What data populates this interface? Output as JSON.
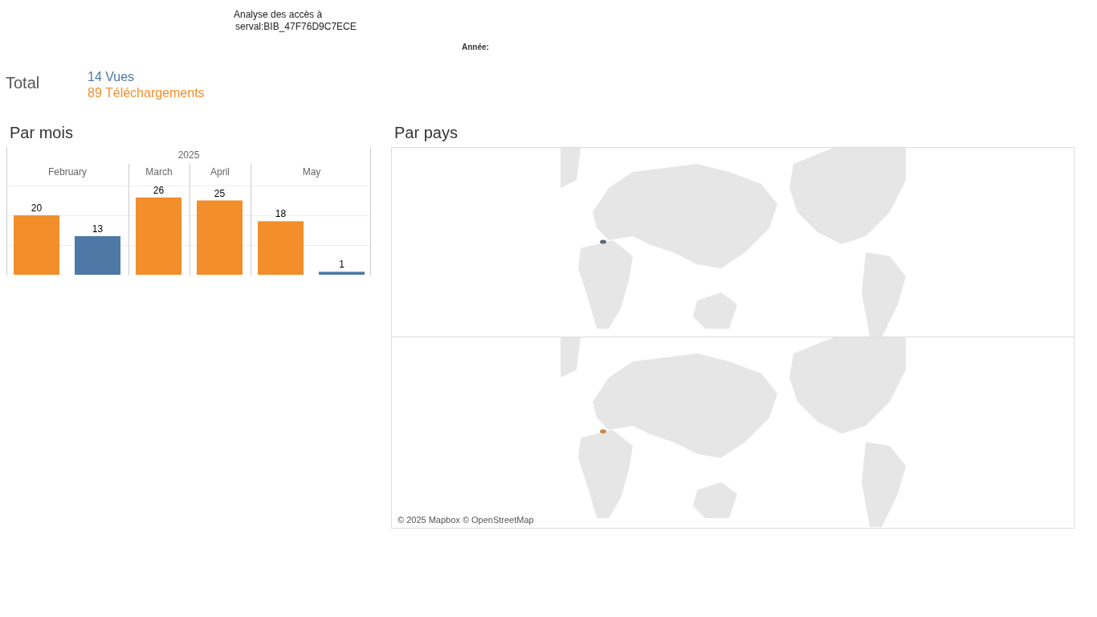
{
  "title": {
    "line_1": "Analyse des accès à",
    "line_2": "serval:BIB_47F76D9C7ECE"
  },
  "filter": {
    "label": "Année:"
  },
  "total": {
    "label": "Total",
    "items": [
      {
        "text": "14 Vues",
        "color": "#4e79a7"
      },
      {
        "text": "89 Téléchargements",
        "color": "#f28e2b"
      }
    ]
  },
  "by_month": {
    "title": "Par mois",
    "chart_data": {
      "type": "bar",
      "title": "2025",
      "categories": [
        "February",
        "March",
        "April",
        "May"
      ],
      "data_labels": true,
      "series": [
        {
          "color": "#f28e2b",
          "values": [
            20,
            26,
            25,
            18
          ]
        },
        {
          "color": "#4e79a7",
          "values": [
            13,
            null,
            null,
            1
          ]
        }
      ]
    }
  },
  "by_country": {
    "title": "Par pays",
    "attribution": "© 2025 Mapbox © OpenStreetMap"
  }
}
